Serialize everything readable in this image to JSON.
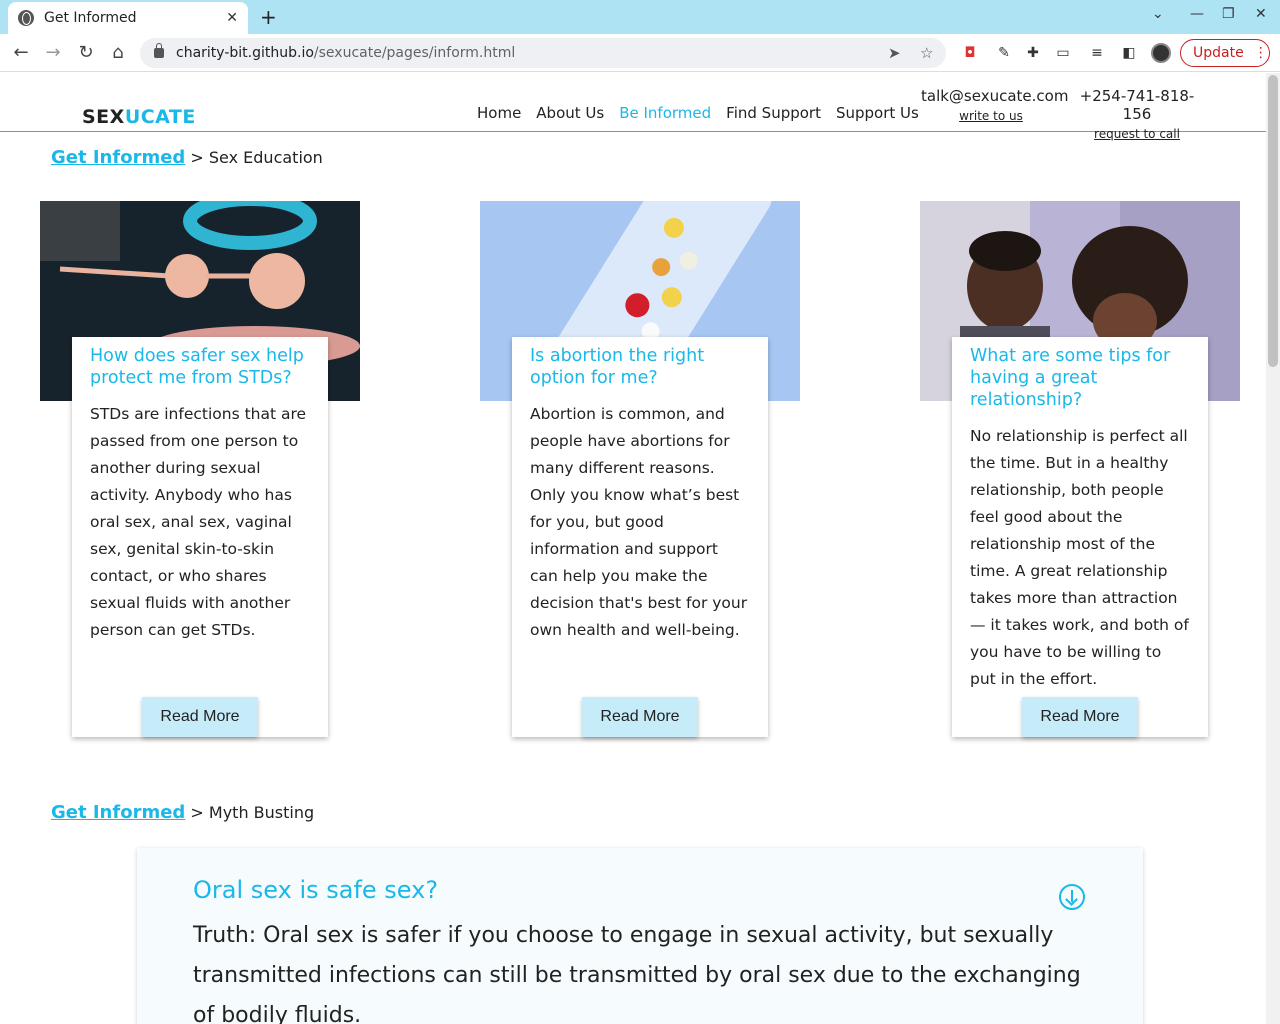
{
  "browser": {
    "tab_title": "Get Informed",
    "url_host": "charity-bit.github.io",
    "url_path": "/sexucate/pages/inform.html",
    "update_label": "Update"
  },
  "site": {
    "logo_part1": "SEX",
    "logo_part2": "UCATE",
    "nav": [
      "Home",
      "About Us",
      "Be Informed",
      "Find Support",
      "Support Us"
    ],
    "active_nav": "Be Informed",
    "email": "talk@sexucate.com",
    "email_link": "write to us",
    "phone": "+254-741-818-156",
    "phone_link": "request to call"
  },
  "sections": {
    "education": {
      "crumb_link": "Get Informed",
      "crumb_sep": ">",
      "crumb_text": "Sex Education"
    },
    "myth": {
      "crumb_link": "Get Informed",
      "crumb_sep": ">",
      "crumb_text": "Myth Busting"
    }
  },
  "cards": [
    {
      "title": "How does safer sex help protect me from STDs?",
      "body": "STDs are infections that are passed from one person to another during sexual activity. Anybody who has oral sex, anal sex, vaginal sex, genital skin-to-skin contact, or who shares sexual fluids with another person can get STDs.",
      "button": "Read More"
    },
    {
      "title": "Is abortion the right option for me?",
      "body": "Abortion is common, and people have abortions for many different reasons. Only you know what’s best for you, but good information and support can help you make the decision that's best for your own health and well-being.",
      "button": "Read More"
    },
    {
      "title": "What are some tips for having a great relationship?",
      "body": "No relationship is perfect all the time. But in a healthy relationship, both people feel good about the relationship most of the time. A great relationship takes more than attraction — it takes work, and both of you have to be willing to put in the effort.",
      "button": "Read More"
    }
  ],
  "myth": {
    "question": "Oral sex is safe sex?",
    "answer": "Truth: Oral sex is safer if you choose to engage in sexual activity, but sexually transmitted infections can still be transmitted by oral sex due to the exchanging of bodily fluids."
  },
  "colors": {
    "accent": "#1ab8e8",
    "button_bg": "#c6ecfa",
    "tabbar": "#aee3f4"
  }
}
